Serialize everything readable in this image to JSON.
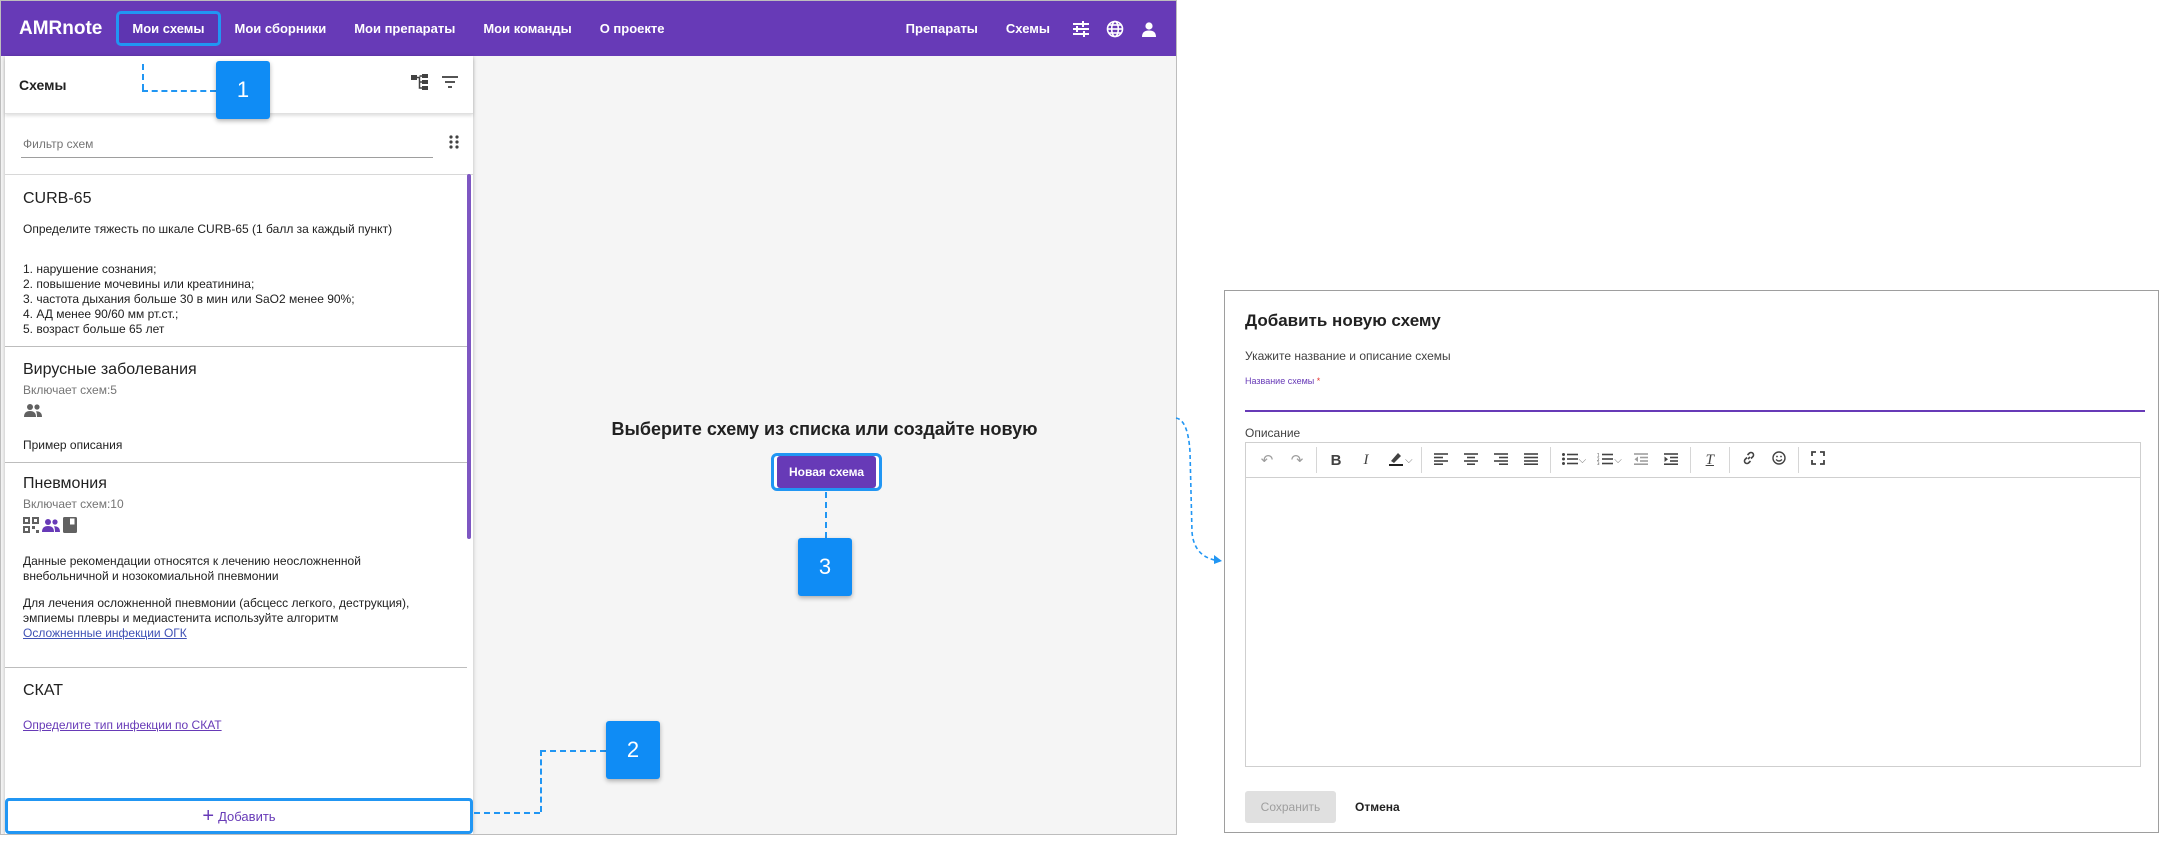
{
  "app": {
    "brand": "AMRnote",
    "nav": [
      "Мои схемы",
      "Мои сборники",
      "Мои препараты",
      "Мои команды",
      "О проекте"
    ],
    "nav_right": [
      "Препараты",
      "Схемы"
    ],
    "accent": "#673ab7",
    "highlight": "#2196f3"
  },
  "sidebar": {
    "title": "Схемы",
    "filter_placeholder": "Фильтр схем",
    "cards": [
      {
        "title": "CURB-65",
        "text": "Определите тяжесть по шкале CURB-65 (1 балл за каждый пункт)",
        "items": [
          "1. нарушение сознания;",
          "2. повышение мочевины или креатинина;",
          "3. частота дыхания больше 30 в мин или SaO2 менее 90%;",
          "4. АД менее 90/60 мм рт.ст.;",
          "5. возраст больше 65 лет"
        ]
      },
      {
        "title": "Вирусные заболевания",
        "sub": "Включает схем:5",
        "text": "Пример описания"
      },
      {
        "title": "Пневмония",
        "sub": "Включает схем:10",
        "text1": "Данные рекомендации относятся к лечению неосложненной внебольничной и нозокомиальной пневмонии",
        "text2": "Для лечения осложненной пневмонии (абсцесс легкого, деструкция), эмпиемы плевры и медиастенита используйте алгоритм ",
        "link": "Осложненные инфекции ОГК"
      },
      {
        "title": "СКАТ",
        "link": "Определите тип инфекции по СКАТ"
      }
    ],
    "add_label": "Добавить"
  },
  "main": {
    "empty_title": "Выберите схему из списка или создайте новую",
    "new_button": "Новая схема"
  },
  "callouts": [
    "1",
    "2",
    "3"
  ],
  "dialog": {
    "title": "Добавить новую схему",
    "subtitle": "Укажите название и описание схемы",
    "name_label": "Название схемы",
    "required_mark": "*",
    "description_label": "Описание",
    "save": "Сохранить",
    "cancel": "Отмена"
  }
}
